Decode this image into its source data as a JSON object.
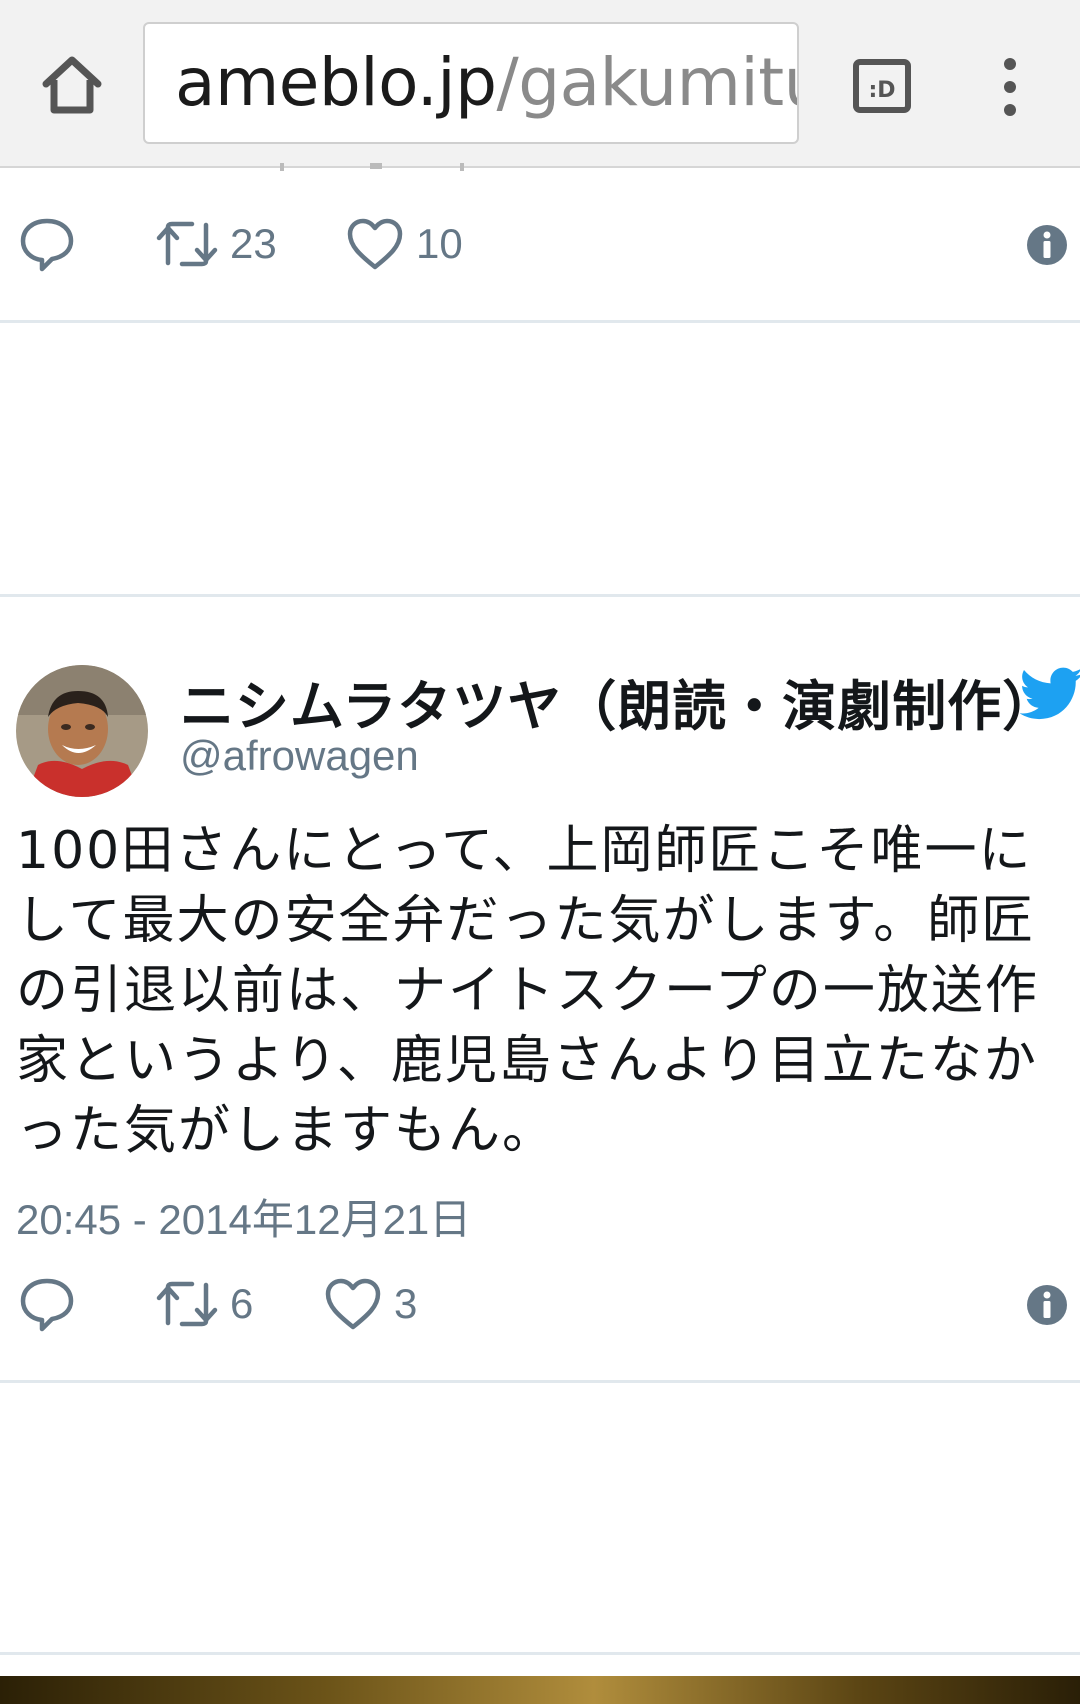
{
  "browser": {
    "url_host": "ameblo.jp",
    "url_path": "/gakumitu",
    "tabs_label": ":D",
    "icons": {
      "home": "home-icon",
      "tabs": "tab-switcher-icon",
      "menu": "overflow-menu-icon"
    }
  },
  "previous_tweet": {
    "retweet_count": "23",
    "like_count": "10"
  },
  "tweet": {
    "display_name": "ニシムラタツヤ（朗読・演劇制作）",
    "handle": "@afrowagen",
    "text": "100田さんにとって、上岡師匠こそ唯一にして最大の安全弁だった気がします。師匠の引退以前は、ナイトスクープの一放送作家というより、鹿児島さんより目立たなかった気がしますもん。",
    "timestamp": "20:45 - 2014年12月21日",
    "retweet_count": "6",
    "like_count": "3"
  },
  "colors": {
    "twitter_blue": "#1da1f2",
    "action_gray": "#657786",
    "divider": "#e1e8ed"
  }
}
